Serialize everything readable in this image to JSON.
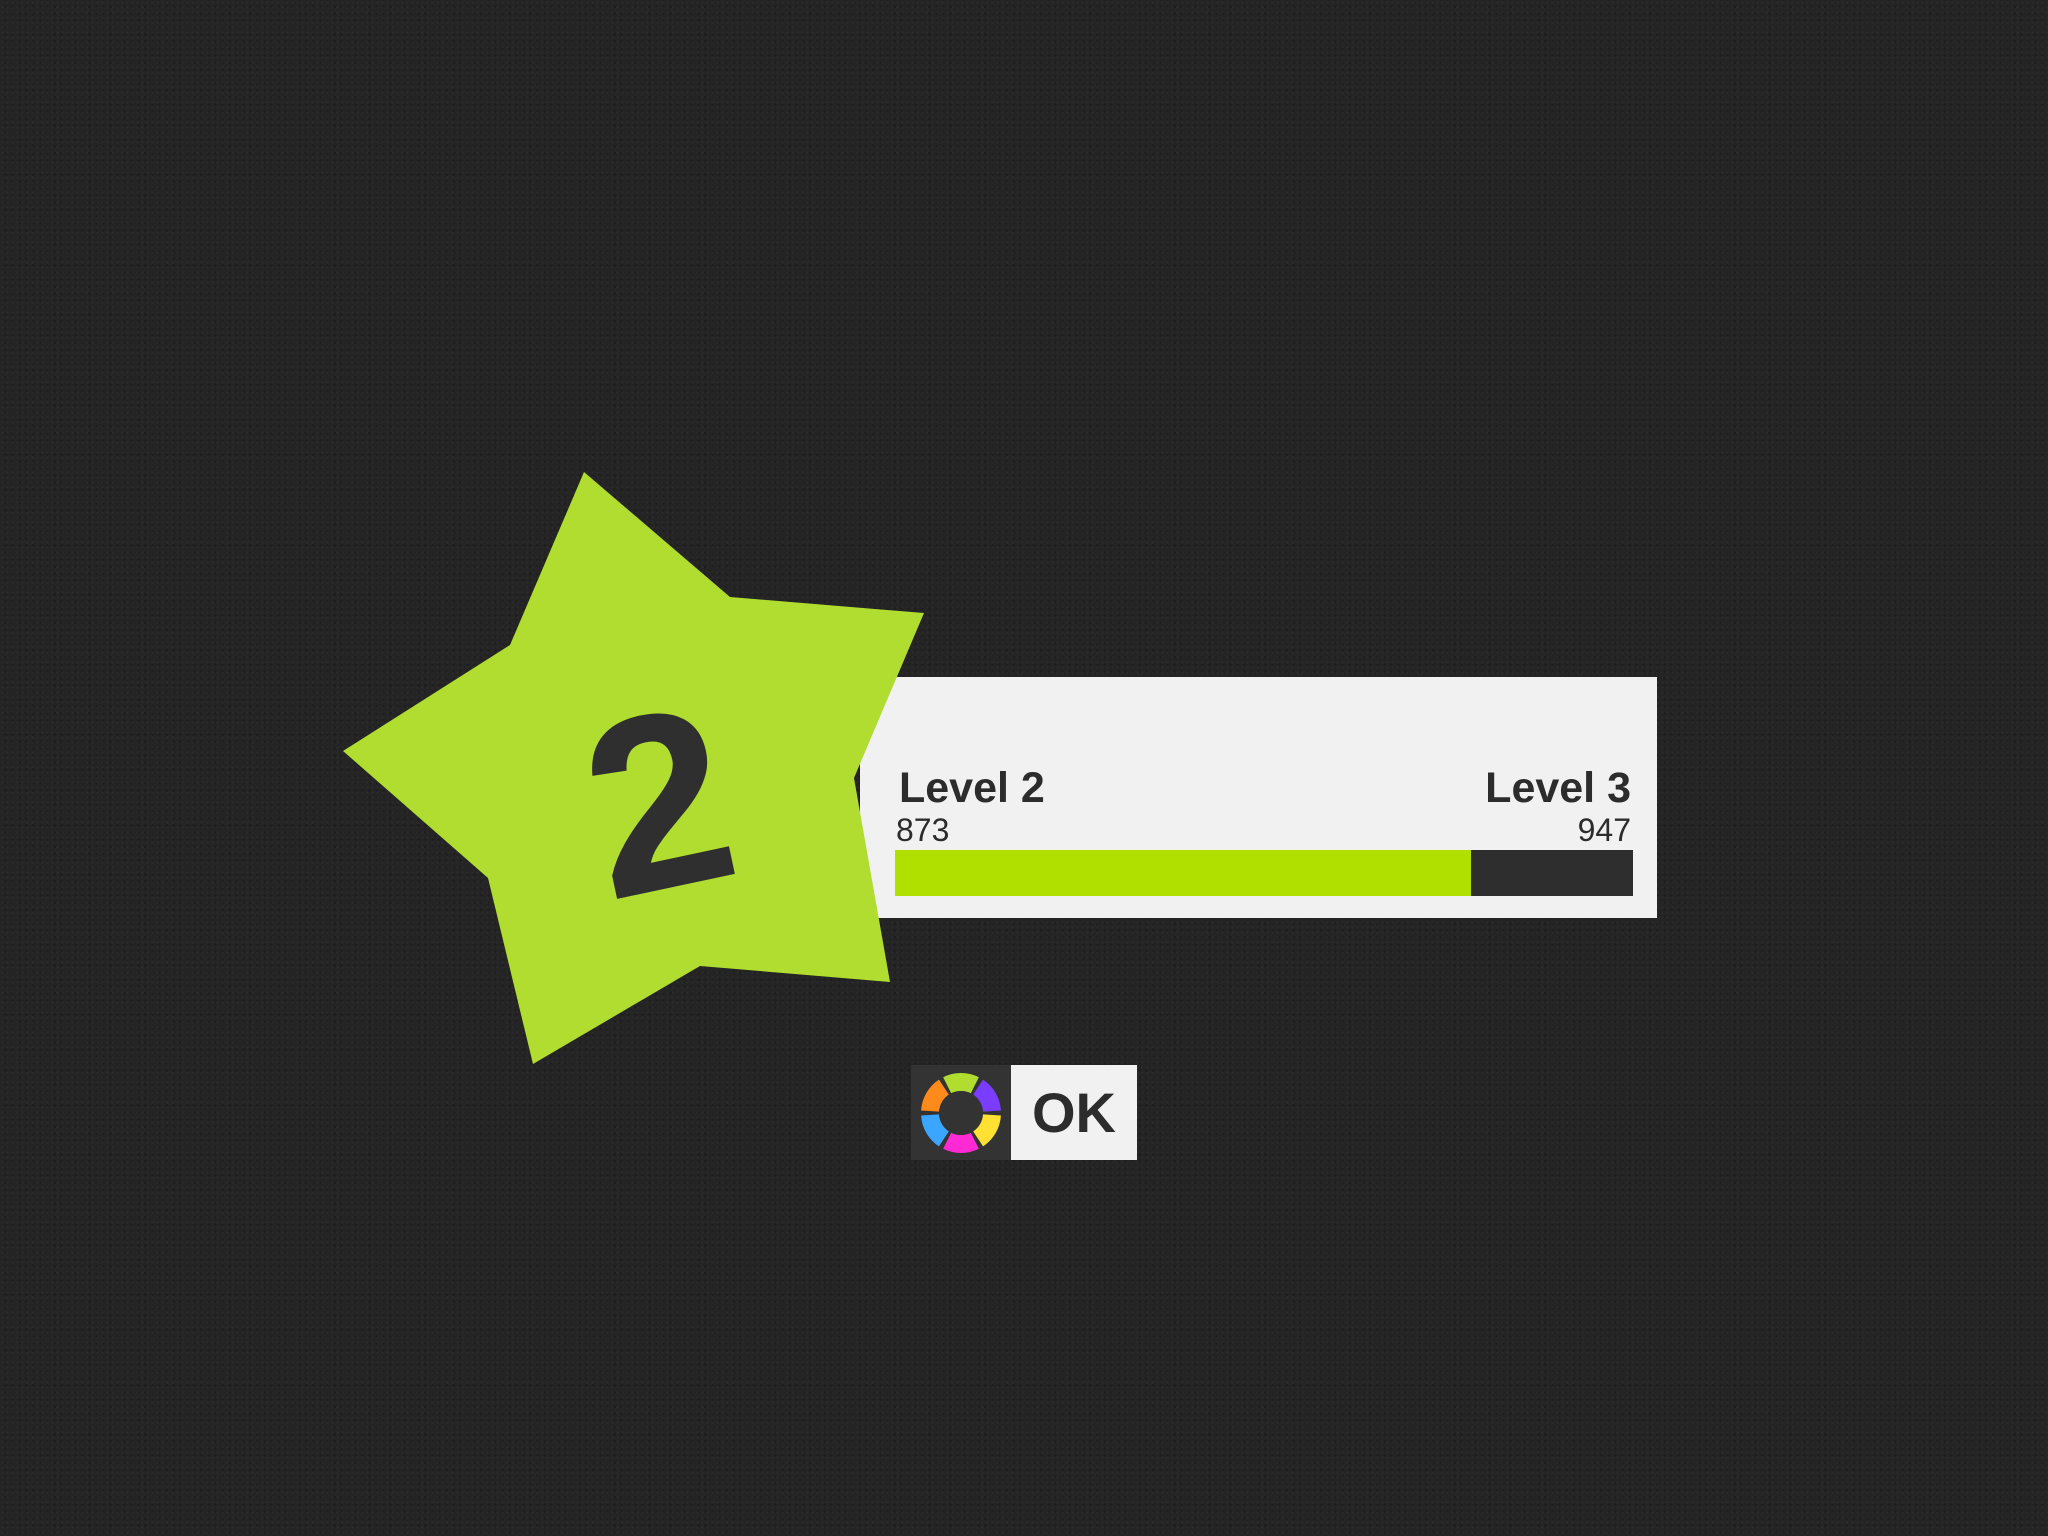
{
  "level_up": {
    "star_number": "2",
    "current_level_label": "Level 2",
    "next_level_label": "Level 3",
    "xp_start": "873",
    "xp_end": "947",
    "progress_fraction": 0.78
  },
  "ok_button": {
    "label": "OK",
    "icon": "color-wheel-icon"
  },
  "colors": {
    "background": "#242424",
    "star": "#b0dd30",
    "progress_fill": "#b0e000",
    "progress_track": "#2e2e2e",
    "panel": "#f1f1f1",
    "text_dark": "#2c2c2c",
    "wheel_segments": [
      "#b0dd30",
      "#7a3cff",
      "#ffe033",
      "#ff2ad4",
      "#3aa6ff",
      "#ff8a1c"
    ]
  }
}
